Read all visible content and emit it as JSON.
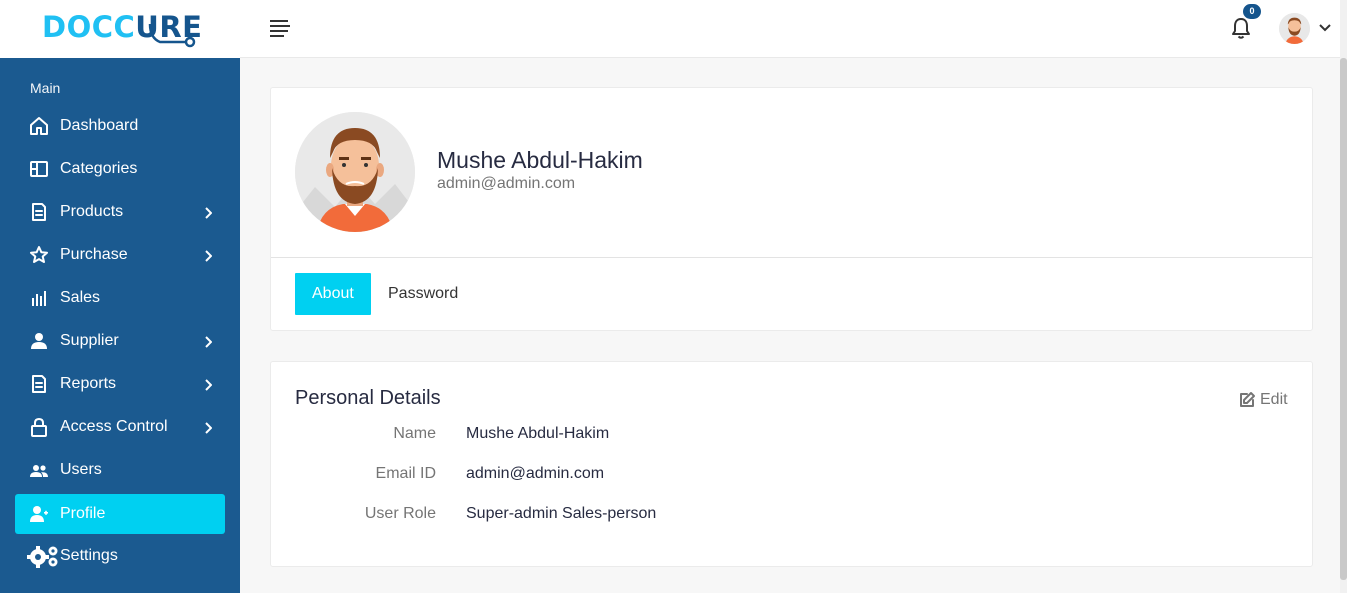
{
  "brand": {
    "logo_doc": "DOCC",
    "logo_cure": "URE"
  },
  "header": {
    "notification_count": "0"
  },
  "sidebar": {
    "section_title": "Main",
    "items": [
      {
        "label": "Dashboard",
        "icon": "home-icon",
        "has_submenu": false,
        "active": false
      },
      {
        "label": "Categories",
        "icon": "layout-icon",
        "has_submenu": false,
        "active": false
      },
      {
        "label": "Products",
        "icon": "document-icon",
        "has_submenu": true,
        "active": false
      },
      {
        "label": "Purchase",
        "icon": "star-icon",
        "has_submenu": true,
        "active": false
      },
      {
        "label": "Sales",
        "icon": "bar-chart-icon",
        "has_submenu": false,
        "active": false
      },
      {
        "label": "Supplier",
        "icon": "person-icon",
        "has_submenu": true,
        "active": false
      },
      {
        "label": "Reports",
        "icon": "document-icon",
        "has_submenu": true,
        "active": false
      },
      {
        "label": "Access Control",
        "icon": "lock-icon",
        "has_submenu": true,
        "active": false
      },
      {
        "label": "Users",
        "icon": "users-icon",
        "has_submenu": false,
        "active": false
      },
      {
        "label": "Profile",
        "icon": "user-plus-icon",
        "has_submenu": false,
        "active": true
      },
      {
        "label": "Settings",
        "icon": "gears-icon",
        "has_submenu": false,
        "active": false
      }
    ]
  },
  "profile": {
    "name": "Mushe Abdul-Hakim",
    "email": "admin@admin.com",
    "tabs": [
      {
        "label": "About",
        "active": true
      },
      {
        "label": "Password",
        "active": false
      }
    ]
  },
  "personal_details": {
    "title": "Personal Details",
    "edit_label": "Edit",
    "rows": [
      {
        "label": "Name",
        "value": "Mushe Abdul-Hakim"
      },
      {
        "label": "Email ID",
        "value": "admin@admin.com"
      },
      {
        "label": "User Role",
        "value": "Super-admin Sales-person"
      }
    ]
  },
  "colors": {
    "sidebar_bg": "#1b5a90",
    "accent": "#00d0f1",
    "logo_light": "#20c0f3",
    "logo_dark": "#15558d"
  }
}
